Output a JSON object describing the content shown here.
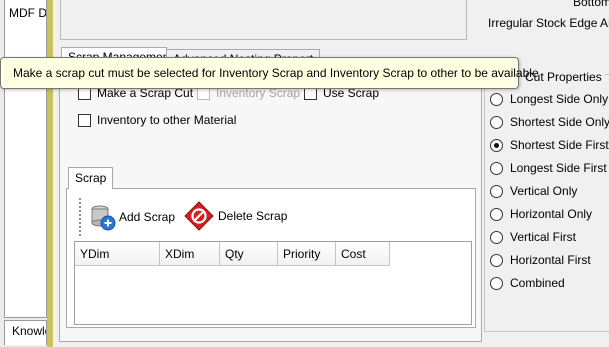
{
  "left_panel": {
    "list_item": "MDF Do",
    "bottom_tab_label": "Knowle"
  },
  "top_box": {
    "label_bottom": "Bottom",
    "label_irregular": "Irregular Stock Edge Allow"
  },
  "tabs": {
    "scrap_management": "Scrap Management",
    "advanced": "Advanced Nesting Propert"
  },
  "tooltip": "Make a scrap cut must be selected for Inventory Scrap and Inventory Scrap to other to be available",
  "checkboxes": {
    "make_scrap_cut": "Make a Scrap Cut",
    "inventory_scrap": "Inventory Scrap",
    "use_scrap": "Use Scrap",
    "inventory_other": "Inventory to other Material"
  },
  "scrap_group": {
    "tab_label": "Scrap",
    "add_label": "Add Scrap",
    "delete_label": "Delete Scrap",
    "columns": [
      "YDim",
      "XDim",
      "Qty",
      "Priority",
      "Cost"
    ]
  },
  "cut_properties": {
    "title": "Cut Properties",
    "options": [
      {
        "label": "Longest Side Only",
        "checked": false
      },
      {
        "label": "Shortest Side Only",
        "checked": false
      },
      {
        "label": "Shortest Side First",
        "checked": true
      },
      {
        "label": "Longest Side First",
        "checked": false
      },
      {
        "label": "Vertical Only",
        "checked": false
      },
      {
        "label": "Horizontal Only",
        "checked": false
      },
      {
        "label": "Vertical First",
        "checked": false
      },
      {
        "label": "Horizontal First",
        "checked": false
      },
      {
        "label": "Combined",
        "checked": false
      }
    ]
  },
  "icons": {
    "add": "add-scrap-icon",
    "delete": "delete-scrap-icon"
  },
  "colors": {
    "splitter": "#c9c35c",
    "tooltip_bg": "#ffffe1",
    "delete_icon": "#d42020",
    "add_icon": "#2a78d6"
  }
}
